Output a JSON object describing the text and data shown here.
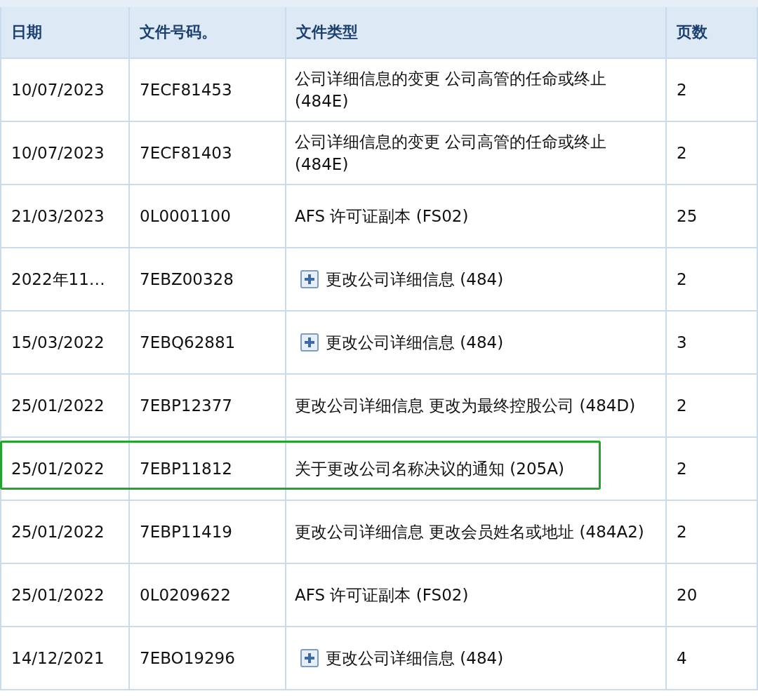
{
  "table": {
    "columns": [
      "日期",
      "文件号码。",
      "文件类型",
      "页数"
    ],
    "rows": [
      {
        "date": "10/07/2023",
        "number": "7ECF81453",
        "type": "公司详细信息的变更 公司高管的任命或终止 (484E)",
        "kind": "plain",
        "pages": "2",
        "highlighted": false
      },
      {
        "date": "10/07/2023",
        "number": "7ECF81403",
        "type": "公司详细信息的变更 公司高管的任命或终止 (484E)",
        "kind": "plain",
        "pages": "2",
        "highlighted": false
      },
      {
        "date": "21/03/2023",
        "number": "0L0001100",
        "type": "AFS 许可证副本 (FS02)",
        "kind": "plain",
        "pages": "25",
        "highlighted": false
      },
      {
        "date": "2022年11…",
        "number": "7EBZ00328",
        "type": "更改公司详细信息 (484)",
        "kind": "expandable",
        "pages": "2",
        "highlighted": false
      },
      {
        "date": "15/03/2022",
        "number": "7EBQ62881",
        "type": "更改公司详细信息 (484)",
        "kind": "expandable",
        "pages": "3",
        "highlighted": false
      },
      {
        "date": "25/01/2022",
        "number": "7EBP12377",
        "type": "更改公司详细信息 更改为最终控股公司 (484D)",
        "kind": "plain",
        "pages": "2",
        "highlighted": false
      },
      {
        "date": "25/01/2022",
        "number": "7EBP11812",
        "type": "关于更改公司名称决议的通知 (205A)",
        "kind": "plain",
        "pages": "2",
        "highlighted": true
      },
      {
        "date": "25/01/2022",
        "number": "7EBP11419",
        "type": "更改公司详细信息 更改会员姓名或地址 (484A2)",
        "kind": "plain",
        "pages": "2",
        "highlighted": false
      },
      {
        "date": "25/01/2022",
        "number": "0L0209622",
        "type": "AFS 许可证副本 (FS02)",
        "kind": "plain",
        "pages": "20",
        "highlighted": false
      },
      {
        "date": "14/12/2021",
        "number": "7EBO19296",
        "type": "更改公司详细信息 (484)",
        "kind": "expandable",
        "pages": "4",
        "highlighted": false
      }
    ]
  }
}
